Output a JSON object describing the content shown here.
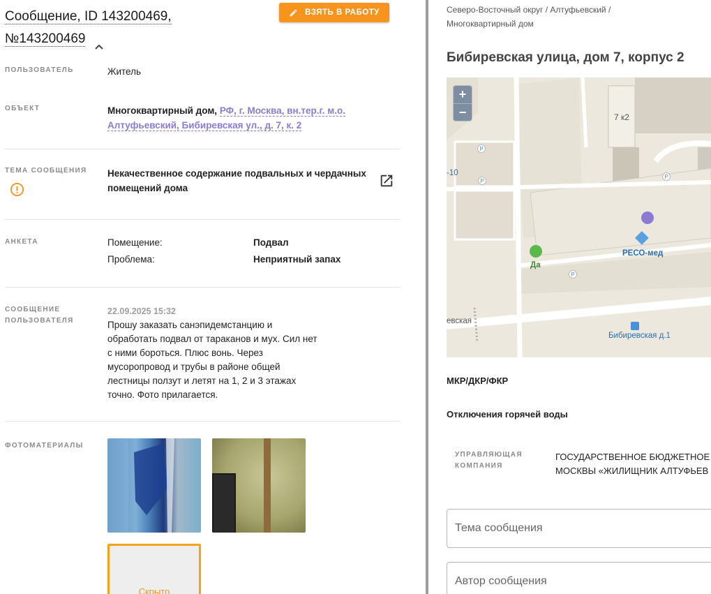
{
  "header": {
    "title_line1": "Сообщение, ID 143200469,",
    "title_line2": "№143200469",
    "work_button": "ВЗЯТЬ В РАБОТУ"
  },
  "user": {
    "label": "ПОЛЬЗОВАТЕЛЬ",
    "value": "Житель"
  },
  "object": {
    "label": "ОБЪЕКТ",
    "prefix": "Многоквартирный дом,",
    "link_line1": "РФ, г. Москва, вн.тер.г. м.о.",
    "link_line2": "Алтуфьевский, Бибиревская ул., д. 7, к. 2"
  },
  "topic": {
    "label": "ТЕМА СООБЩЕНИЯ",
    "line1": "Некачественное содержание подвальных и чердачных",
    "line2": "помещений дома"
  },
  "survey": {
    "label": "АНКЕТА",
    "rows": [
      {
        "key": "Помещение:",
        "value": "Подвал"
      },
      {
        "key": "Проблема:",
        "value": "Неприятный запах"
      }
    ]
  },
  "message": {
    "label_line1": "СООБЩЕНИЕ",
    "label_line2": "ПОЛЬЗОВАТЕЛЯ",
    "datetime": "22.09.2025 15:32",
    "lines": [
      "Прошу заказать санэпидемстанцию и",
      "обработать подвал от тараканов и мух. Сил нет",
      "с ними бороться. Плюс вонь. Через",
      "мусоропровод и трубы в районе общей",
      "лестницы ползут и летят на 1, 2 и 3 этажах",
      "точно. Фото прилагается."
    ]
  },
  "photos": {
    "label": "ФОТОМАТЕРИАЛЫ",
    "hidden_label": "Скрыто"
  },
  "right": {
    "breadcrumb_line1": "Северо-Восточный округ / Алтуфьевский /",
    "breadcrumb_line2": "Многоквартирный дом",
    "address": "Бибиревская улица, дом 7, корпус 2",
    "map": {
      "zoom_in": "+",
      "zoom_out": "−",
      "building_label": "7 к2",
      "poi_reso": "РЕСО-мед",
      "poi_shop": "Да",
      "street_label": "евская",
      "bus_stop": "Бибиревская д.1",
      "road_num": "-10",
      "parking": "P"
    },
    "section_mkr": "МКР/ДКР/ФКР",
    "section_hotwater": "Отключения горячей воды",
    "mc_label_line1": "УПРАВЛЯЮЩАЯ",
    "mc_label_line2": "КОМПАНИЯ",
    "mc_value_line1": "ГОСУДАРСТВЕННОЕ БЮДЖЕТНОЕ",
    "mc_value_line2": "МОСКВЫ «ЖИЛИЩНИК АЛТУФЬЕВ",
    "field_topic_placeholder": "Тема сообщения",
    "field_author_placeholder": "Автор сообщения"
  },
  "colors": {
    "accent_orange": "#f7941d",
    "link_purple": "#8a7dd1",
    "map_marker": "#8a7dd1"
  }
}
